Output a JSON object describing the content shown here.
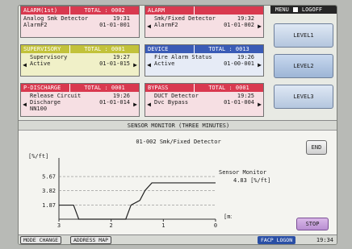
{
  "panels": [
    {
      "category": "ALARM(1st)",
      "total": "TOTAL : 0002",
      "line1_left": "Analog Smk Detector",
      "line1_right": "19:31",
      "line2_left": "AlarmF2",
      "line2_right": "01-01-001",
      "line3": ""
    },
    {
      "category": "ALARM",
      "total": "",
      "line1_left": "Smk/Fixed Detector",
      "line1_right": "19:32",
      "line2_left": "AlarmF2",
      "line2_right": "01-01-002",
      "line3": ""
    },
    {
      "category": "SUPERVISORY",
      "total": "TOTAL : 0001",
      "line1_left": "Supervisory",
      "line1_right": "19:27",
      "line2_left": "Active",
      "line2_right": "01-01-015",
      "line3": ""
    },
    {
      "category": "DEVICE",
      "total": "TOTAL : 0013",
      "line1_left": "Fire Alarm Status",
      "line1_right": "19:26",
      "line2_left": "Active",
      "line2_right": "01-00-001",
      "line3": ""
    },
    {
      "category": "P-DISCHARGE",
      "total": "TOTAL : 0001",
      "line1_left": "Release Circuit",
      "line1_right": "19:26",
      "line2_left": "Discharge",
      "line2_right": "01-01-014",
      "line3": "NN100"
    },
    {
      "category": "BYPASS",
      "total": "TOTAL : 0001",
      "line1_left": "DUCT Detector",
      "line1_right": "19:25",
      "line2_left": "Dvc Bypass",
      "line2_right": "01-01-004",
      "line3": ""
    }
  ],
  "menu": {
    "menu_label": "MENU",
    "logoff_label": "LOGOFF"
  },
  "levels": [
    "LEVEL1",
    "LEVEL2",
    "LEVEL3"
  ],
  "monitor": {
    "title": "SENSOR MONITOR (THREE MINUTES)",
    "device": "01-002  Smk/Fixed Detector",
    "end_label": "END",
    "stop_label": "STOP",
    "readout_label": "Sensor Monitor",
    "readout_value": "4.83  [%/ft]"
  },
  "chart_data": {
    "type": "line",
    "ylabel": "[%/ft]",
    "xlabel": "[minutes]",
    "y_ticks": [
      "5.67",
      "3.82",
      "1.87"
    ],
    "x_ticks": [
      "3",
      "2",
      "1",
      "0"
    ],
    "ylim": [
      0,
      7.5
    ],
    "xlim": [
      3,
      0
    ],
    "series": [
      {
        "x": [
          3.0,
          2.72,
          2.62,
          1.72,
          1.62,
          1.45,
          1.35,
          1.22,
          0.0
        ],
        "y": [
          1.87,
          1.87,
          0.0,
          0.0,
          1.87,
          2.5,
          3.82,
          4.83,
          4.83
        ]
      }
    ]
  },
  "footer": {
    "mode_change": "MODE CHANGE",
    "address_map": "ADDRESS MAP",
    "facp_logon": "FACP LOGON",
    "time": "19:34"
  }
}
